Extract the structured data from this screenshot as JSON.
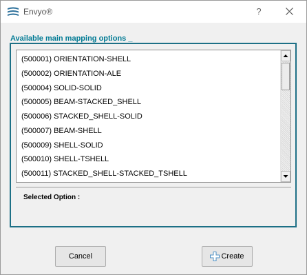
{
  "window": {
    "title": "Envyo®",
    "help_label": "?"
  },
  "group": {
    "title": "Available main mapping options _"
  },
  "options": [
    "(500001) ORIENTATION-SHELL",
    "(500002) ORIENTATION-ALE",
    "(500004) SOLID-SOLID",
    "(500005) BEAM-STACKED_SHELL",
    "(500006) STACKED_SHELL-SOLID",
    "(500007) BEAM-SHELL",
    "(500009) SHELL-SOLID",
    "(500010) SHELL-TSHELL",
    "(500011) STACKED_SHELL-STACKED_TSHELL"
  ],
  "selected": {
    "label": "Selected Option :"
  },
  "buttons": {
    "cancel": "Cancel",
    "create": "Create"
  },
  "icons": {
    "app": "envyo-logo-icon",
    "help": "help-icon",
    "close": "close-icon",
    "scroll_up": "arrow-up-icon",
    "scroll_down": "arrow-down-icon",
    "create": "plus-icon"
  },
  "colors": {
    "accent": "#1d7086",
    "group_title": "#007a94",
    "plus_icon": "#4a8fc4"
  }
}
